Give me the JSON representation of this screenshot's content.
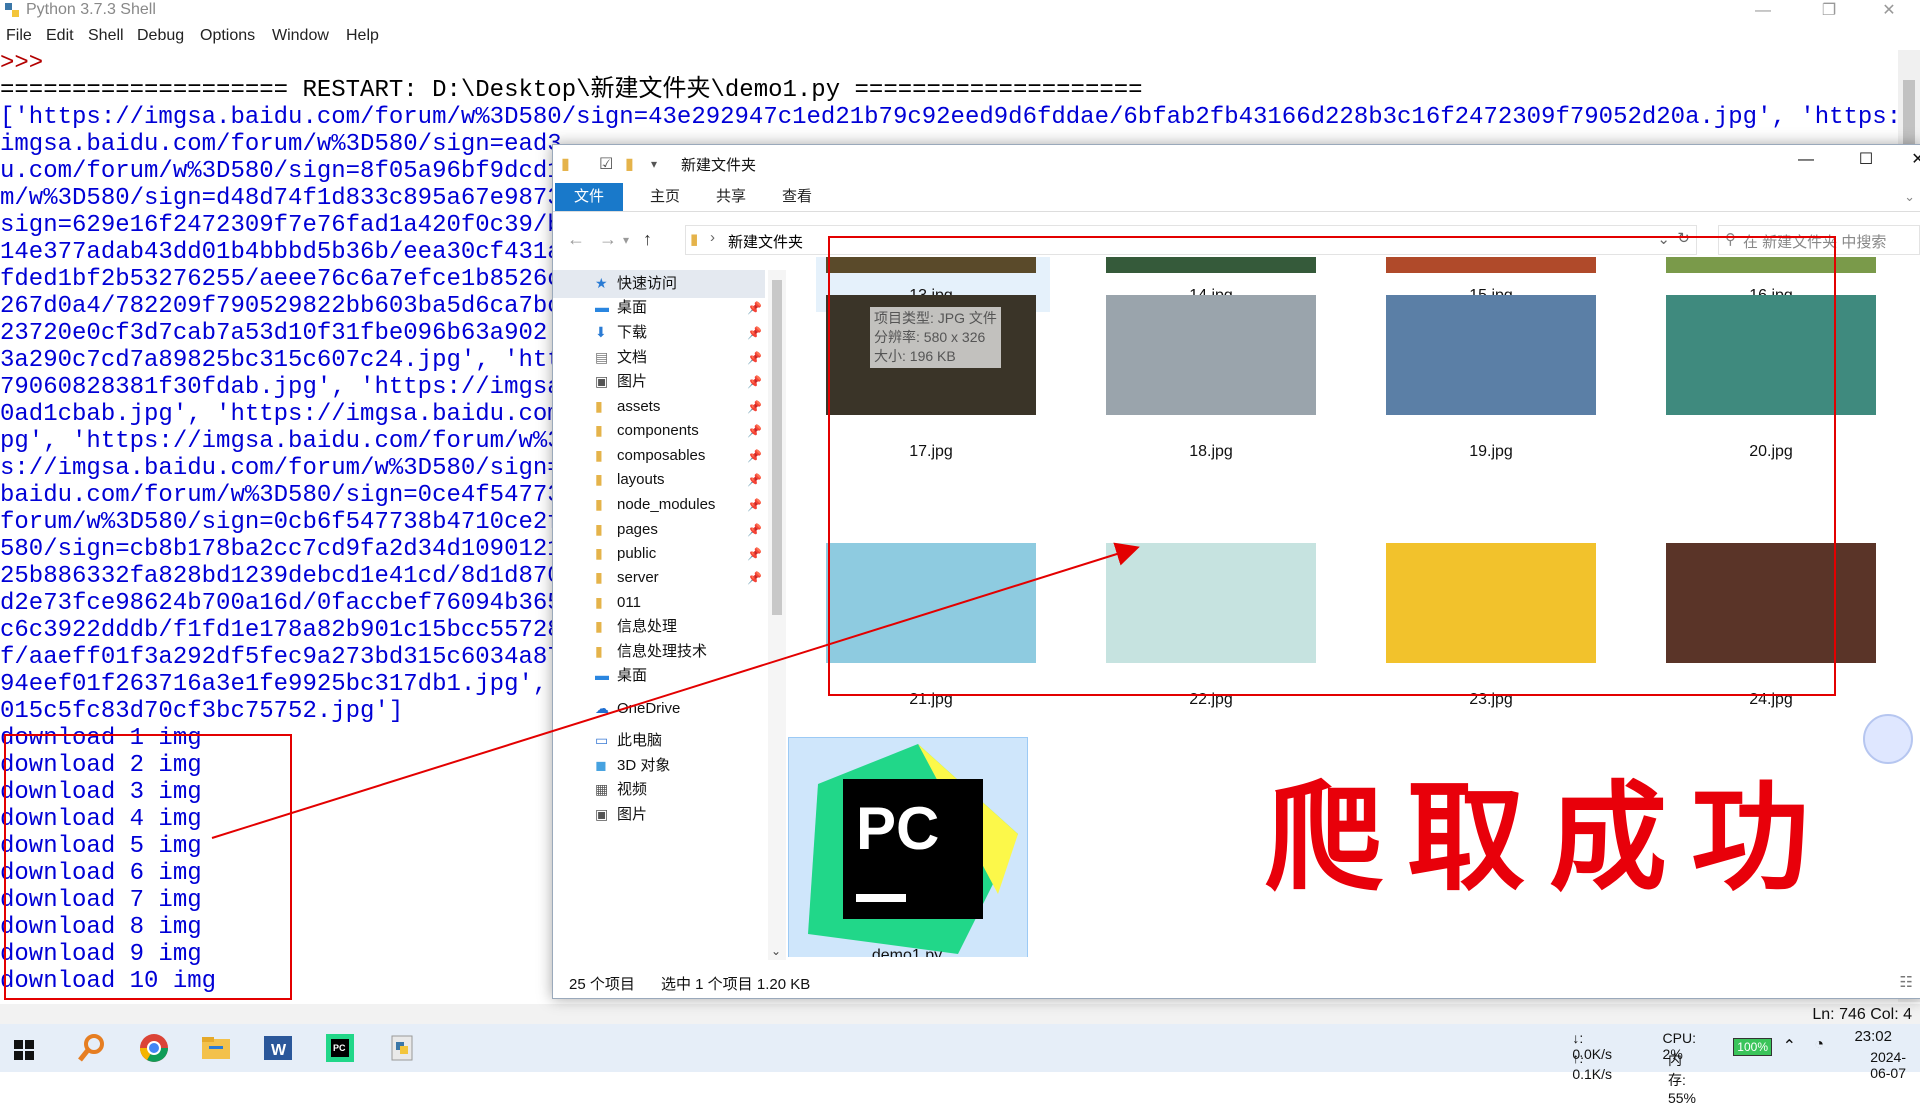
{
  "idle": {
    "title": "Python 3.7.3 Shell",
    "menu": [
      "File",
      "Edit",
      "Shell",
      "Debug",
      "Options",
      "Window",
      "Help"
    ],
    "shell_lines": [
      ">>>",
      "==================== RESTART: D:\\Desktop\\新建文件夹\\demo1.py ====================",
      "['https://imgsa.baidu.com/forum/w%3D580/sign=43e292947c1ed21b79c92eed9d6fddae/6bfab2fb43166d228b3c16f2472309f79052d20a.jpg', 'https://",
      "imgsa.baidu.com/forum/w%3D580/sign=ead3",
      "u.com/forum/w%3D580/sign=8f05a96bf9dcd1",
      "m/w%3D580/sign=d48d74f1d833c895a67e9873",
      "sign=629e16f2472309f7e76fad1a420f0c39/b",
      "14e377adab43dd01b4bbbd5b36b/eea30cf431a",
      "fded1bf2b53276255/aeee76c6a7efce1b8526c",
      "267d0a4/782209f790529822bb603ba5d6ca7bc",
      "23720e0cf3d7cab7a53d10f31fbe096b63a902.",
      "3a290c7cd7a89825bc315c607c24.jpg', 'htt",
      "79060828381f30fdab.jpg', 'https://imgsa",
      "0ad1cbab.jpg', 'https://imgsa.baidu.com",
      "pg', 'https://imgsa.baidu.com/forum/w%3",
      "s://imgsa.baidu.com/forum/w%3D580/sign=",
      "baidu.com/forum/w%3D580/sign=0ce4f54773",
      "forum/w%3D580/sign=0cb6f547738b4710ce2f",
      "580/sign=cb8b178ba2cc7cd9fa2d34d1090121",
      "25b886332fa828bd1239debcd1e41cd/8d1d870",
      "d2e73fce98624b700a16d/0faccbef76094b365",
      "c6c3922dddb/f1fd1e178a82b901c15bcc55728",
      "f/aaeff01f3a292df5fec9a273bd315c6034a87",
      "94eef01f263716a3e1fe9925bc317db1.jpg',",
      "015c5fc83d70cf3bc75752.jpg']",
      "download 1 img",
      "download 2 img",
      "download 3 img",
      "download 4 img",
      "download 5 img",
      "download 6 img",
      "download 7 img",
      "download 8 img",
      "download 9 img",
      "download 10 img"
    ],
    "status": "Ln: 746   Col: 4"
  },
  "explorer": {
    "title": "新建文件夹",
    "ribbon_tabs": [
      "文件",
      "主页",
      "共享",
      "查看"
    ],
    "address": "新建文件夹",
    "search_placeholder": "在 新建文件夹 中搜索",
    "nav": [
      {
        "label": "快速访问",
        "icon": "star-icon",
        "pin": false
      },
      {
        "label": "桌面",
        "icon": "desktop-icon",
        "pin": true
      },
      {
        "label": "下载",
        "icon": "download-icon",
        "pin": true
      },
      {
        "label": "文档",
        "icon": "document-icon",
        "pin": true
      },
      {
        "label": "图片",
        "icon": "pictures-icon",
        "pin": true
      },
      {
        "label": "assets",
        "icon": "folder-icon",
        "pin": true
      },
      {
        "label": "components",
        "icon": "folder-icon",
        "pin": true
      },
      {
        "label": "composables",
        "icon": "folder-icon",
        "pin": true
      },
      {
        "label": "layouts",
        "icon": "folder-icon",
        "pin": true
      },
      {
        "label": "node_modules",
        "icon": "folder-icon",
        "pin": true
      },
      {
        "label": "pages",
        "icon": "folder-icon",
        "pin": true
      },
      {
        "label": "public",
        "icon": "folder-icon",
        "pin": true
      },
      {
        "label": "server",
        "icon": "folder-icon",
        "pin": true
      },
      {
        "label": "011",
        "icon": "folder-icon",
        "pin": false
      },
      {
        "label": "信息处理",
        "icon": "folder-icon",
        "pin": false
      },
      {
        "label": "信息处理技术",
        "icon": "folder-icon",
        "pin": false
      },
      {
        "label": "桌面",
        "icon": "desktop-icon",
        "pin": false
      },
      {
        "label": "OneDrive",
        "icon": "cloud-icon",
        "pin": false
      },
      {
        "label": "此电脑",
        "icon": "computer-icon",
        "pin": false
      },
      {
        "label": "3D 对象",
        "icon": "cube-icon",
        "pin": false
      },
      {
        "label": "视频",
        "icon": "video-icon",
        "pin": false
      },
      {
        "label": "图片",
        "icon": "pictures-icon",
        "pin": false
      }
    ],
    "files": [
      {
        "name": "13.jpg",
        "color": "#5a4a2a"
      },
      {
        "name": "14.jpg",
        "color": "#355a3a"
      },
      {
        "name": "15.jpg",
        "color": "#b04a2a"
      },
      {
        "name": "16.jpg",
        "color": "#7a9a4a"
      },
      {
        "name": "17.jpg",
        "color": "#3a3428"
      },
      {
        "name": "18.jpg",
        "color": "#9aa4ac"
      },
      {
        "name": "19.jpg",
        "color": "#5b7fa6"
      },
      {
        "name": "20.jpg",
        "color": "#3f8a7e"
      },
      {
        "name": "21.jpg",
        "color": "#8ecbe0"
      },
      {
        "name": "22.jpg",
        "color": "#c6e3e0"
      },
      {
        "name": "23.jpg",
        "color": "#f2c22c"
      },
      {
        "name": "24.jpg",
        "color": "#5a3428"
      },
      {
        "name": "demo1.py",
        "color": "#1fd18a"
      }
    ],
    "tooltip": [
      "项目类型: JPG 文件",
      "分辨率: 580 x 326",
      "大小: 196 KB"
    ],
    "status_count": "25 个项目",
    "status_selected": "选中 1 个项目  1.20 KB"
  },
  "overlay_text": "爬取成功",
  "taskbar": {
    "net_down": "↓: 0.0K/s",
    "net_up": "↑: 0.1K/s",
    "cpu": "CPU: 2%",
    "mem": "内存: 55%",
    "battery": "100%",
    "time": "23:02",
    "date": "2024-06-07"
  }
}
